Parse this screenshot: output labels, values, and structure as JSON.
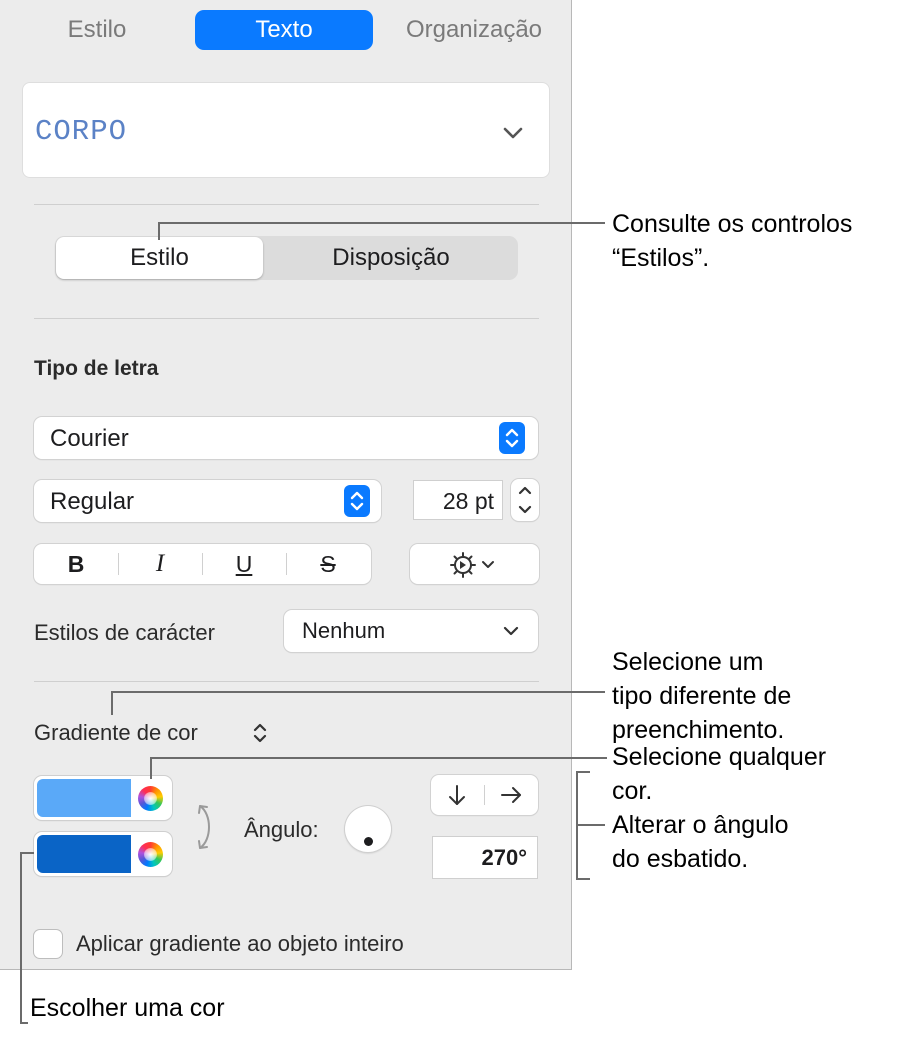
{
  "tabs": [
    {
      "label": "Estilo",
      "active": false
    },
    {
      "label": "Texto",
      "active": true
    },
    {
      "label": "Organização",
      "active": false
    }
  ],
  "paragraph_style": {
    "name": "CORPO"
  },
  "segmented": {
    "style_label": "Estilo",
    "layout_label": "Disposição",
    "selected": "Estilo"
  },
  "font": {
    "section_title": "Tipo de letra",
    "family": "Courier",
    "typeface": "Regular",
    "size": "28 pt",
    "bold_label": "B",
    "italic_label": "I",
    "underline_label": "U",
    "strike_label": "S",
    "character_styles_label": "Estilos de carácter",
    "character_styles_value": "Nenhum"
  },
  "fill": {
    "type_label": "Gradiente de cor",
    "color1": "#5aa9f8",
    "color2": "#0a64c6",
    "angle_label": "Ângulo:",
    "angle_value": "270°",
    "apply_whole_label": "Aplicar gradiente ao objeto inteiro",
    "apply_whole_checked": false
  },
  "callouts": {
    "styles_line1": "Consulte os controlos",
    "styles_line2": "“Estilos”.",
    "fill_type_line1": "Selecione um",
    "fill_type_line2": "tipo diferente de",
    "fill_type_line3": "preenchimento.",
    "any_color_line1": "Selecione qualquer",
    "any_color_line2": "cor.",
    "angle_line1": "Alterar o ângulo",
    "angle_line2": "do esbatido.",
    "color_line1": "Escolher uma cor"
  },
  "colors": {
    "accent": "#0a7aff",
    "panel_bg": "#ececec"
  }
}
